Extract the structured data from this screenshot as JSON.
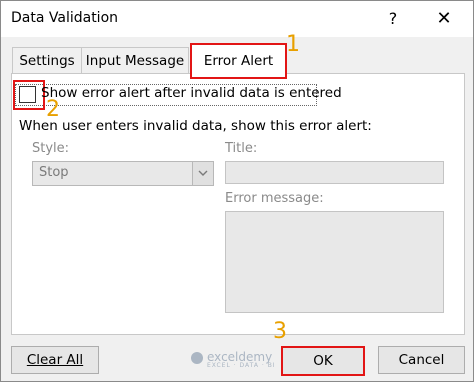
{
  "window": {
    "title": "Data Validation",
    "help_glyph": "?",
    "close_glyph": "✕"
  },
  "tabs": [
    {
      "label": "Settings"
    },
    {
      "label": "Input Message"
    },
    {
      "label": "Error Alert",
      "selected": true
    }
  ],
  "error_alert": {
    "show_alert_label": "Show error alert after invalid data is entered",
    "show_alert_checked": false,
    "group_label": "When user enters invalid data, show this error alert:",
    "style_label": "Style:",
    "style_value": "Stop",
    "title_label": "Title:",
    "title_value": "",
    "message_label": "Error message:",
    "message_value": ""
  },
  "buttons": {
    "clear_all": "Clear All",
    "ok": "OK",
    "cancel": "Cancel"
  },
  "callouts": {
    "one": "1",
    "two": "2",
    "three": "3"
  },
  "watermark": {
    "name": "exceldemy",
    "tagline": "EXCEL · DATA · BI"
  },
  "colors": {
    "highlight": "#e21515",
    "callout_number": "#e8a000"
  }
}
